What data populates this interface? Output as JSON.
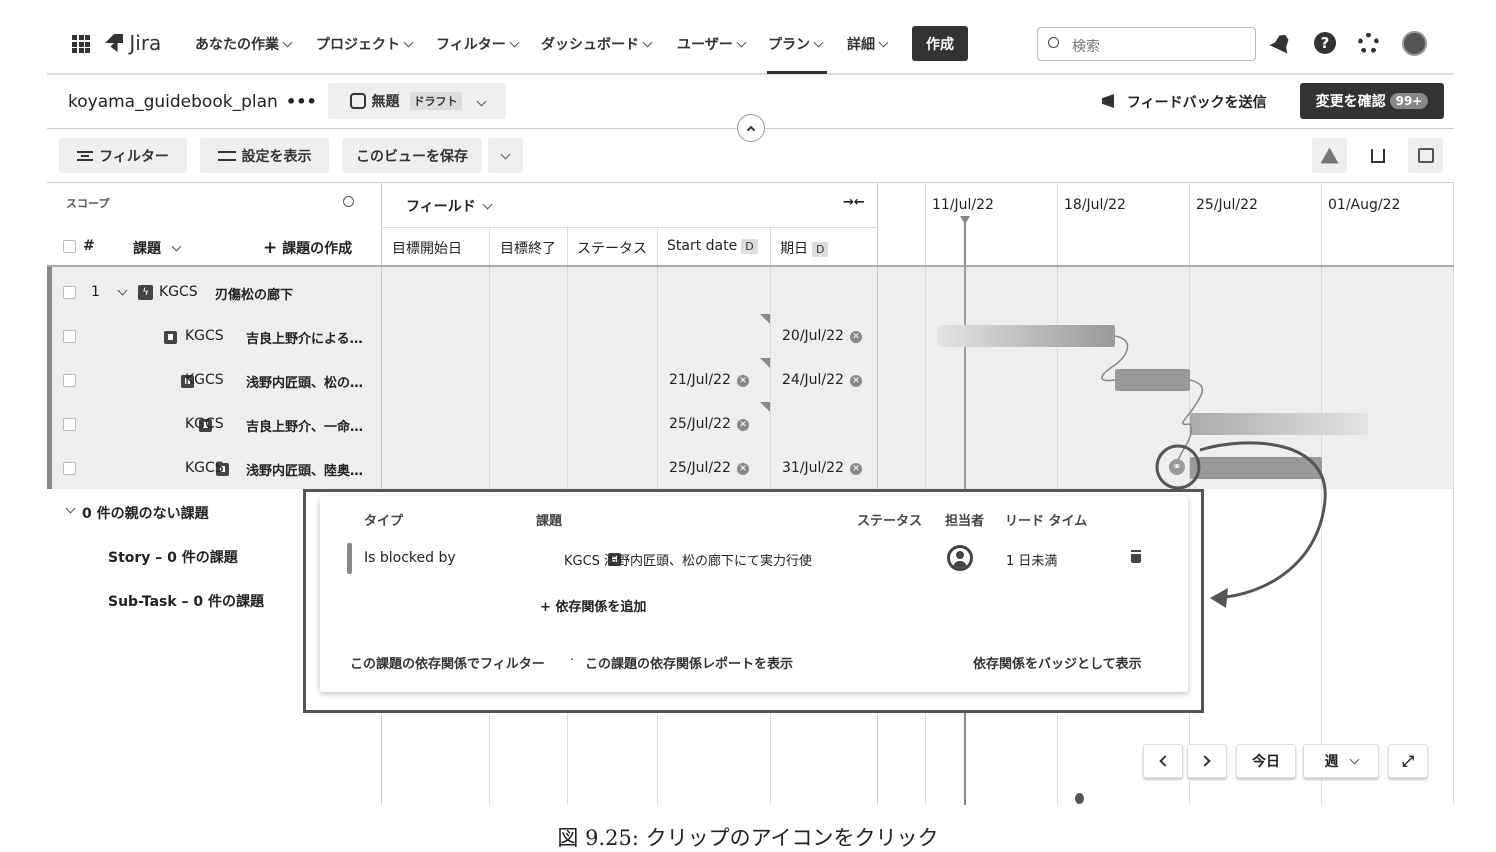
{
  "nav": {
    "logo": "Jira",
    "items": [
      "あなたの作業",
      "プロジェクト",
      "フィルター",
      "ダッシュボード",
      "ユーザー",
      "プラン",
      "詳細"
    ],
    "create": "作成",
    "search_placeholder": "検索"
  },
  "plan": {
    "name": "koyama_guidebook_plan",
    "more": "•••",
    "scenario": "無題",
    "draft": "ドラフト",
    "feedback": "フィードバックを送信",
    "review": "変更を確認",
    "review_count": "99+"
  },
  "toolbar": {
    "filter": "フィルター",
    "view_settings": "設定を表示",
    "save_view": "このビューを保存"
  },
  "scope": {
    "label": "スコープ",
    "col_num": "#",
    "col_issue": "課題",
    "create_issue": "課題の作成"
  },
  "fields": {
    "label": "フィールド",
    "cols": [
      "目標開始日",
      "目標終了",
      "ステータス",
      "Start date",
      "期日"
    ],
    "badge": "D"
  },
  "timeline": {
    "dates": [
      "11/Jul/22",
      "18/Jul/22",
      "25/Jul/22",
      "01/Aug/22"
    ]
  },
  "rows": [
    {
      "num": "1",
      "key": "KGCS",
      "summary": "刃傷松の廊下",
      "start": "",
      "due": ""
    },
    {
      "num": "",
      "key": "KGCS",
      "summary": "吉良上野介による…",
      "start": "",
      "due": "20/Jul/22"
    },
    {
      "num": "",
      "key": "KGCS",
      "summary": "浅野内匠頭、松の…",
      "start": "21/Jul/22",
      "due": "24/Jul/22"
    },
    {
      "num": "",
      "key": "KGCS",
      "summary": "吉良上野介、一命…",
      "start": "25/Jul/22",
      "due": ""
    },
    {
      "num": "",
      "key": "KGCS",
      "summary": "浅野内匠頭、陸奥…",
      "start": "25/Jul/22",
      "due": "31/Jul/22"
    }
  ],
  "orphans": {
    "title": "0 件の親のない課題",
    "story": "Story – 0 件の課題",
    "subtask": "Sub-Task – 0 件の課題"
  },
  "popup": {
    "headers": [
      "タイプ",
      "課題",
      "ステータス",
      "担当者",
      "リード タイム"
    ],
    "type": "Is blocked by",
    "issue": "KGCS 浅野内匠頭、松の廊下にて実力行使",
    "lead": "1 日未満",
    "add": "+ 依存関係を追加",
    "filter_link": "この課題の依存関係でフィルター",
    "dot": "·",
    "report_link": "この課題の依存関係レポートを表示",
    "badge_link": "依存関係をバッジとして表示"
  },
  "bottom": {
    "today": "今日",
    "week": "週"
  },
  "caption": "図 9.25: クリップのアイコンをクリック"
}
